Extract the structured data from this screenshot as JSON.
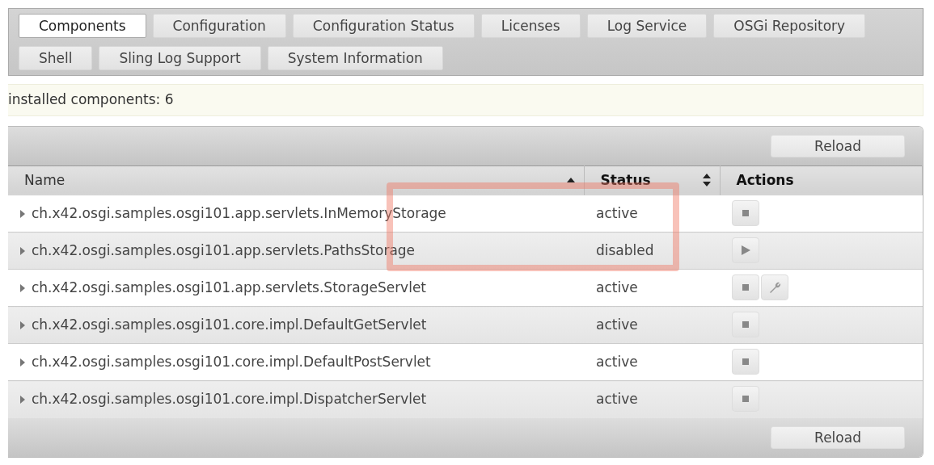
{
  "tabs": [
    {
      "label": "Components",
      "selected": true
    },
    {
      "label": "Configuration",
      "selected": false
    },
    {
      "label": "Configuration Status",
      "selected": false
    },
    {
      "label": "Licenses",
      "selected": false
    },
    {
      "label": "Log Service",
      "selected": false
    },
    {
      "label": "OSGi Repository",
      "selected": false
    },
    {
      "label": "Shell",
      "selected": false
    },
    {
      "label": "Sling Log Support",
      "selected": false
    },
    {
      "label": "System Information",
      "selected": false
    }
  ],
  "status_line": "installed components: 6",
  "reload_buttons": [
    "Reload",
    "Reload"
  ],
  "table": {
    "columns": [
      {
        "label": "Name",
        "sorted": true,
        "sortable": true
      },
      {
        "label": "Status",
        "sorted": false,
        "sortable": true
      },
      {
        "label": "Actions",
        "sorted": false,
        "sortable": false
      }
    ],
    "rows": [
      {
        "name": "ch.x42.osgi.samples.osgi101.app.servlets.InMemoryStorage",
        "status": "active",
        "highlighted": true,
        "actions": [
          {
            "kind": "stop"
          }
        ]
      },
      {
        "name": "ch.x42.osgi.samples.osgi101.app.servlets.PathsStorage",
        "status": "disabled",
        "highlighted": true,
        "actions": [
          {
            "kind": "start"
          }
        ]
      },
      {
        "name": "ch.x42.osgi.samples.osgi101.app.servlets.StorageServlet",
        "status": "active",
        "highlighted": false,
        "actions": [
          {
            "kind": "stop"
          },
          {
            "kind": "configure"
          }
        ]
      },
      {
        "name": "ch.x42.osgi.samples.osgi101.core.impl.DefaultGetServlet",
        "status": "active",
        "highlighted": false,
        "actions": [
          {
            "kind": "stop"
          }
        ]
      },
      {
        "name": "ch.x42.osgi.samples.osgi101.core.impl.DefaultPostServlet",
        "status": "active",
        "highlighted": false,
        "actions": [
          {
            "kind": "stop"
          }
        ]
      },
      {
        "name": "ch.x42.osgi.samples.osgi101.core.impl.DispatcherServlet",
        "status": "active",
        "highlighted": false,
        "actions": [
          {
            "kind": "stop"
          }
        ]
      }
    ]
  }
}
